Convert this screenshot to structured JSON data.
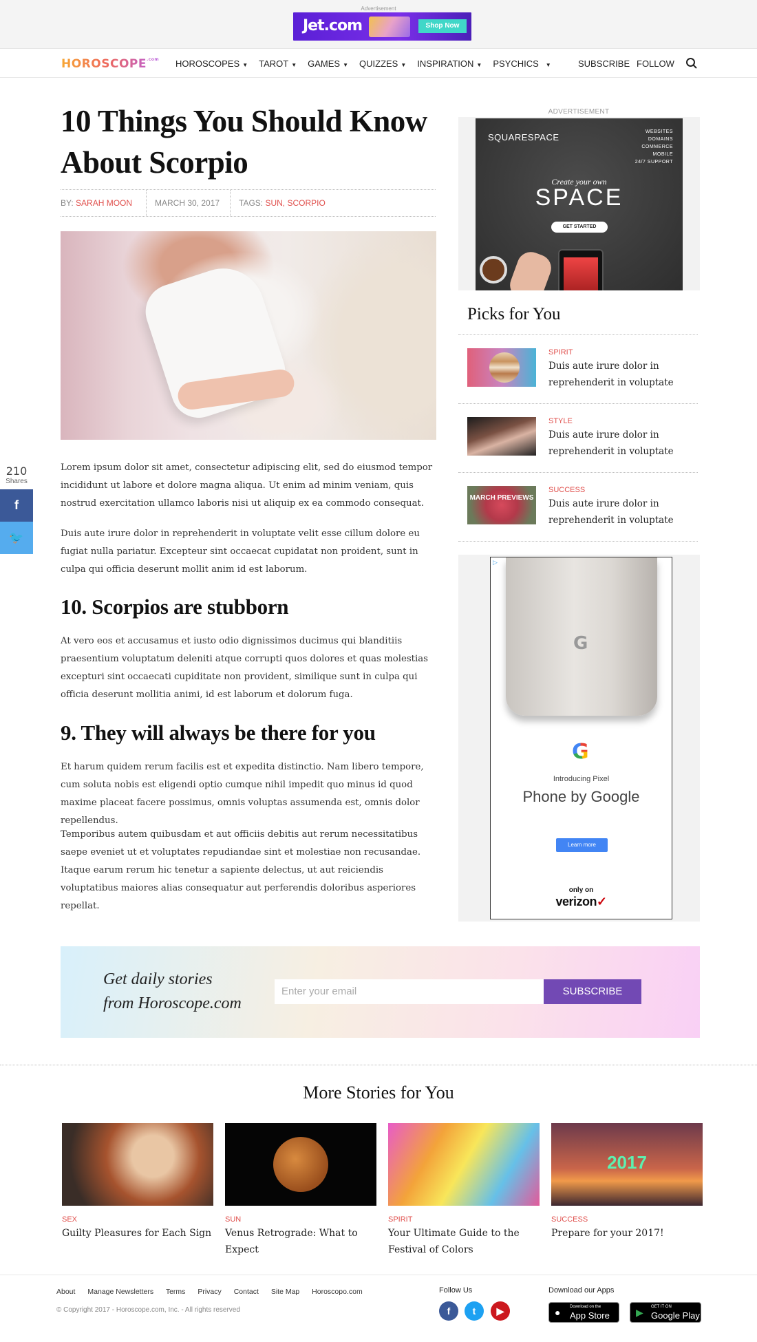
{
  "ad_label": "Advertisement",
  "top_ad": {
    "logo": "Jet.com",
    "cta": "Shop Now"
  },
  "nav": {
    "brand": "HOROSCOPE",
    "brand_suffix": ".com",
    "items": [
      {
        "label": "HOROSCOPES"
      },
      {
        "label": "TAROT"
      },
      {
        "label": "GAMES"
      },
      {
        "label": "QUIZZES"
      },
      {
        "label": "INSPIRATION"
      },
      {
        "label": "PSYCHICS"
      }
    ],
    "subscribe": "SUBSCRIBE",
    "follow": "FOLLOW"
  },
  "article": {
    "title": "10 Things You Should Know About Scorpio",
    "by_label": "BY:",
    "author": "SARAH MOON",
    "date": "MARCH 30, 2017",
    "tags_label": "TAGS:",
    "tags": "SUN, SCORPIO",
    "p1": "Lorem ipsum dolor sit amet, consectetur adipiscing elit, sed do eiusmod tempor incididunt ut labore et dolore magna aliqua. Ut enim ad minim veniam, quis nostrud exercitation ullamco laboris nisi ut aliquip ex ea commodo consequat.",
    "p2": "Duis aute irure dolor in reprehenderit in voluptate velit esse cillum dolore eu fugiat nulla pariatur. Excepteur sint occaecat cupidatat non proident, sunt in culpa qui officia deserunt mollit anim id est laborum.",
    "h10": "10. Scorpios are stubborn",
    "p3": "At vero eos et accusamus et iusto odio dignissimos ducimus qui blanditiis praesentium voluptatum deleniti atque corrupti quos dolores et quas molestias excepturi sint occaecati cupiditate non provident, similique sunt in culpa qui officia deserunt mollitia animi, id est laborum et dolorum fuga.",
    "h9": "9. They will always be there for you",
    "p4": "Et harum quidem rerum facilis est et expedita distinctio. Nam libero tempore, cum soluta nobis est eligendi optio cumque nihil impedit quo minus id quod maxime placeat facere possimus, omnis voluptas assumenda est, omnis dolor repellendus.",
    "p5": "Temporibus autem quibusdam et aut officiis debitis aut rerum necessitatibus saepe eveniet ut et voluptates repudiandae sint et molestiae non recusandae. Itaque earum rerum hic tenetur a sapiente delectus, ut aut reiciendis voluptatibus maiores alias consequatur aut perferendis doloribus asperiores repellat."
  },
  "share": {
    "count": "210",
    "label": "Shares",
    "facebook_icon": "f",
    "twitter_icon": "🐦"
  },
  "sidebar": {
    "ad_label": "ADVERTISEMENT",
    "squarespace": {
      "logo": "SQUARESPACE",
      "list": [
        "WEBSITES",
        "DOMAINS",
        "COMMERCE",
        "MOBILE",
        "24/7 SUPPORT"
      ],
      "tagline": "Create your own",
      "headline": "SPACE",
      "cta": "GET STARTED"
    },
    "picks_title": "Picks for You",
    "picks": [
      {
        "category": "SPIRIT",
        "title": "Duis aute irure dolor in reprehenderit in voluptate"
      },
      {
        "category": "STYLE",
        "title": "Duis aute irure dolor in reprehenderit in voluptate"
      },
      {
        "category": "SUCCESS",
        "title": "Duis aute irure dolor in reprehenderit in voluptate",
        "thumb_text": "MARCH PREVIEWS"
      }
    ],
    "pixel_ad": {
      "intro": "Introducing Pixel",
      "headline": "Phone by Google",
      "cta": "Learn more",
      "only_on": "only on",
      "carrier": "verizon"
    }
  },
  "newsletter": {
    "slogan_line1": "Get daily stories",
    "slogan_line2": "from Horoscope.com",
    "placeholder": "Enter your email",
    "button": "SUBSCRIBE"
  },
  "more": {
    "title": "More Stories for You",
    "stories": [
      {
        "category": "SEX",
        "title": "Guilty Pleasures for Each Sign"
      },
      {
        "category": "SUN",
        "title": "Venus Retrograde: What to Expect"
      },
      {
        "category": "SPIRIT",
        "title": "Your Ultimate Guide to the Festival of Colors"
      },
      {
        "category": "SUCCESS",
        "title": "Prepare for your 2017!",
        "image_text": "2017"
      }
    ]
  },
  "footer": {
    "links": [
      "About",
      "Manage Newsletters",
      "Terms",
      "Privacy",
      "Contact",
      "Site Map",
      "Horoscopo.com"
    ],
    "copyright": "© Copyright 2017 - Horoscope.com, Inc. - All rights reserved",
    "follow_us": "Follow Us",
    "download": "Download our Apps",
    "appstore_small": "Download on the",
    "appstore": "App Store",
    "googleplay_small": "GET IT ON",
    "googleplay": "Google Play"
  }
}
